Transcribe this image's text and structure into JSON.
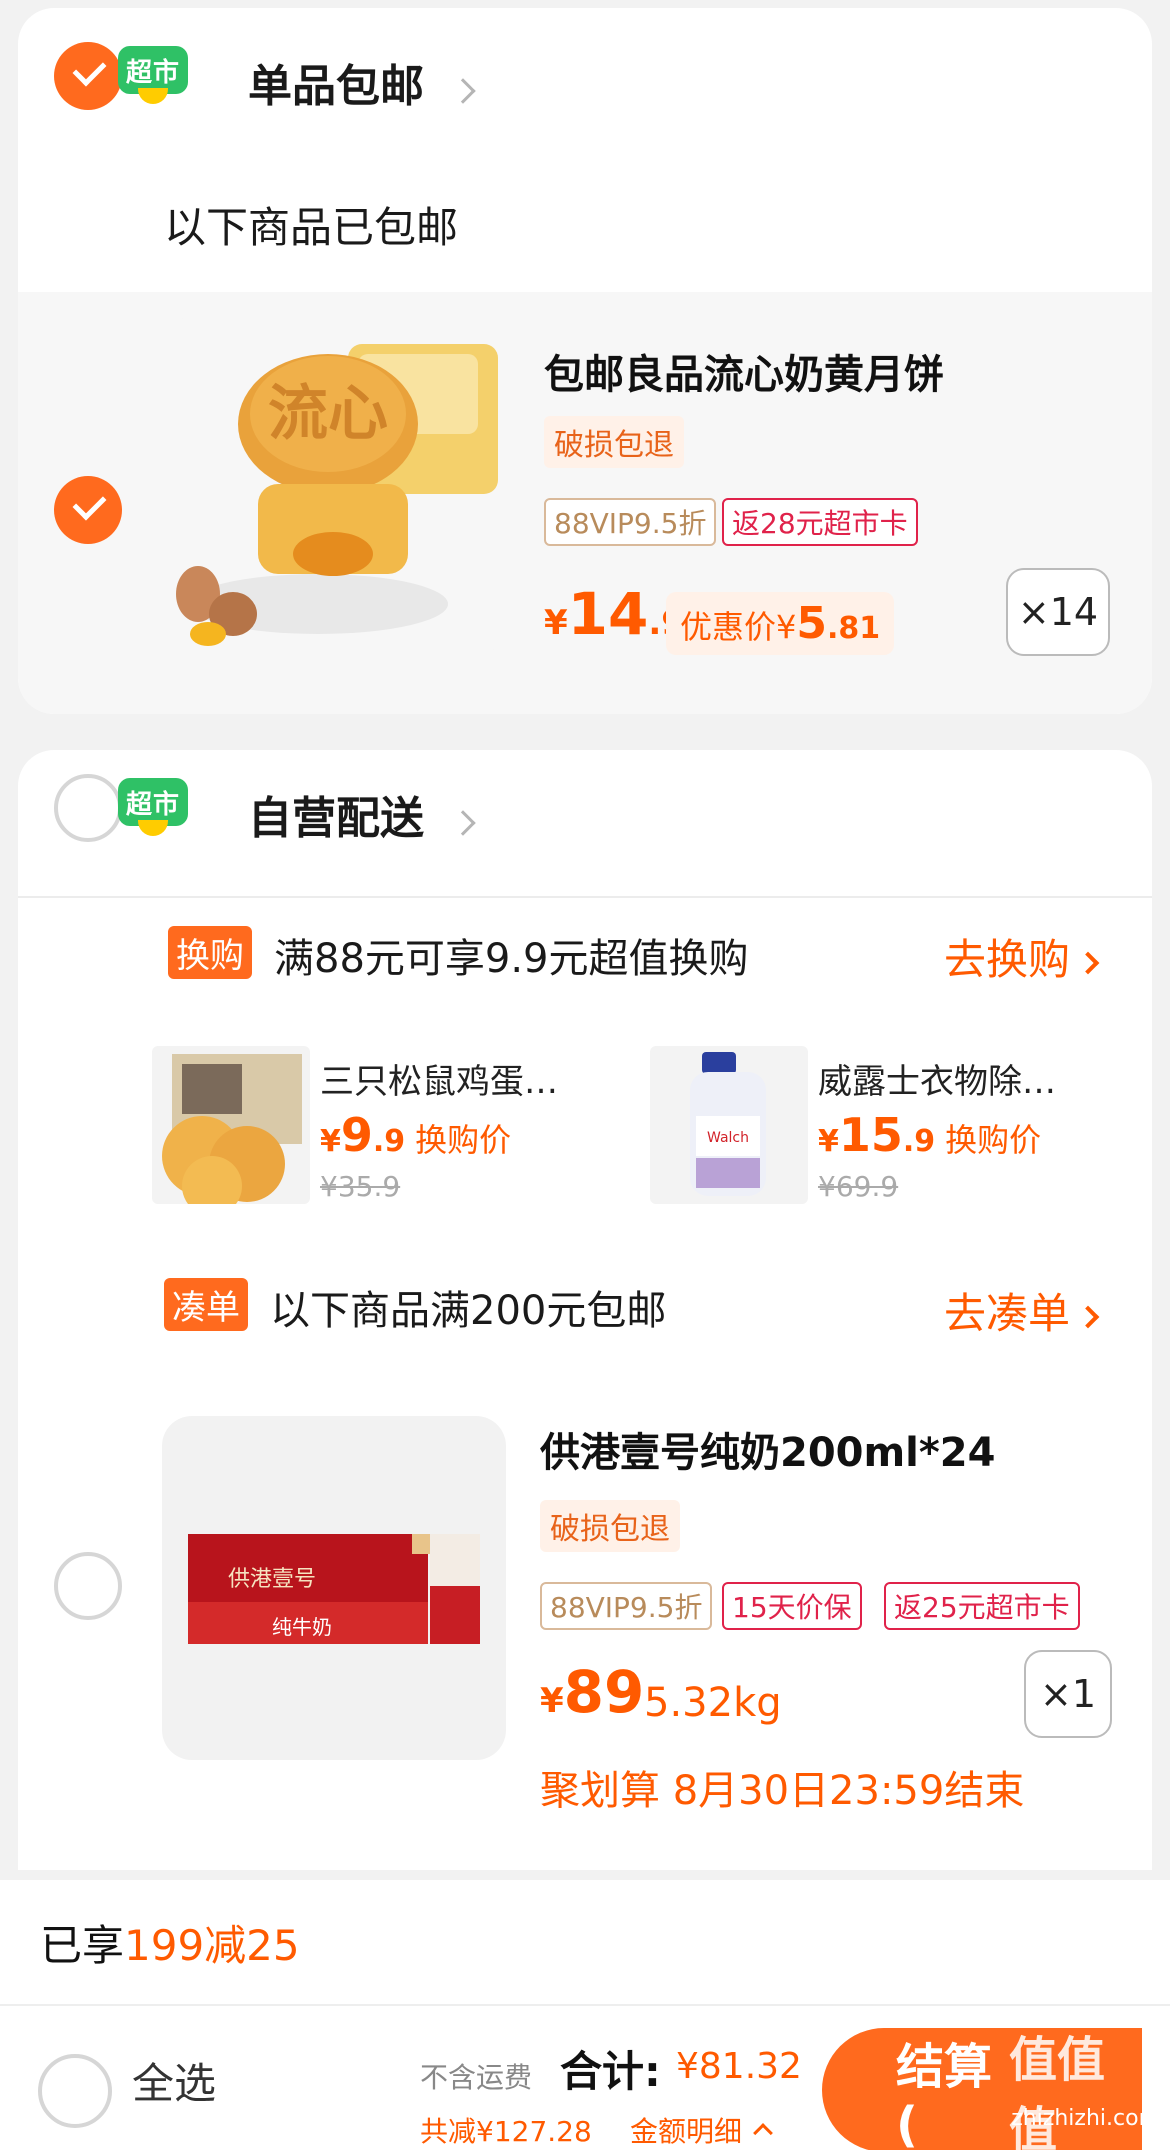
{
  "group1": {
    "badge": "超市",
    "title": "单品包邮",
    "subtitle": "以下商品已包邮",
    "item": {
      "name": "包邮良品流心奶黄月饼",
      "tag_return": "破损包退",
      "tag_vip": "88VIP9.5折",
      "tag_card": "返28元超市卡",
      "price_symbol": "¥",
      "price_int": "14",
      "price_dec": ".9",
      "promo_label": "优惠价¥",
      "promo_int": "5",
      "promo_dec": ".81",
      "quantity": "×14"
    }
  },
  "group2": {
    "badge": "超市",
    "title": "自营配送",
    "swap": {
      "badge": "换购",
      "text": "满88元可享9.9元超值换购",
      "link": "去换购",
      "items": [
        {
          "name": "三只松鼠鸡蛋…",
          "price_symbol": "¥",
          "price_int": "9",
          "price_dec": ".9",
          "label": "换购价",
          "old_price": "¥35.9"
        },
        {
          "name": "威露士衣物除…",
          "price_symbol": "¥",
          "price_int": "15",
          "price_dec": ".9",
          "label": "换购价",
          "old_price": "¥69.9"
        }
      ]
    },
    "bundle": {
      "badge": "凑单",
      "text": "以下商品满200元包邮",
      "link": "去凑单"
    },
    "item": {
      "name": "供港壹号纯奶200ml*24",
      "tag_return": "破损包退",
      "tag_vip": "88VIP9.5折",
      "tag_guarantee": "15天价保",
      "tag_card": "返25元超市卡",
      "price_symbol": "¥",
      "price_int": "89",
      "weight": "5.32kg",
      "quantity": "×1",
      "deal": "聚划算 8月30日23:59结束"
    }
  },
  "tip": {
    "prefix": "已享",
    "highlight": "199减25"
  },
  "bottom": {
    "select_all": "全选",
    "shipping_note": "不含运费",
    "total_label": "合计:",
    "total_value": "¥81.32",
    "reduced": "共减¥127.28",
    "detail": "金额明细",
    "checkout": "结算(",
    "watermark": "值值值",
    "watermark_url": "zhizhizhi.com"
  },
  "colors": {
    "accent": "#ff6a1e",
    "price": "#ff5a00",
    "tag_red": "#e0224a",
    "chaoshi_green": "#2fc166"
  }
}
